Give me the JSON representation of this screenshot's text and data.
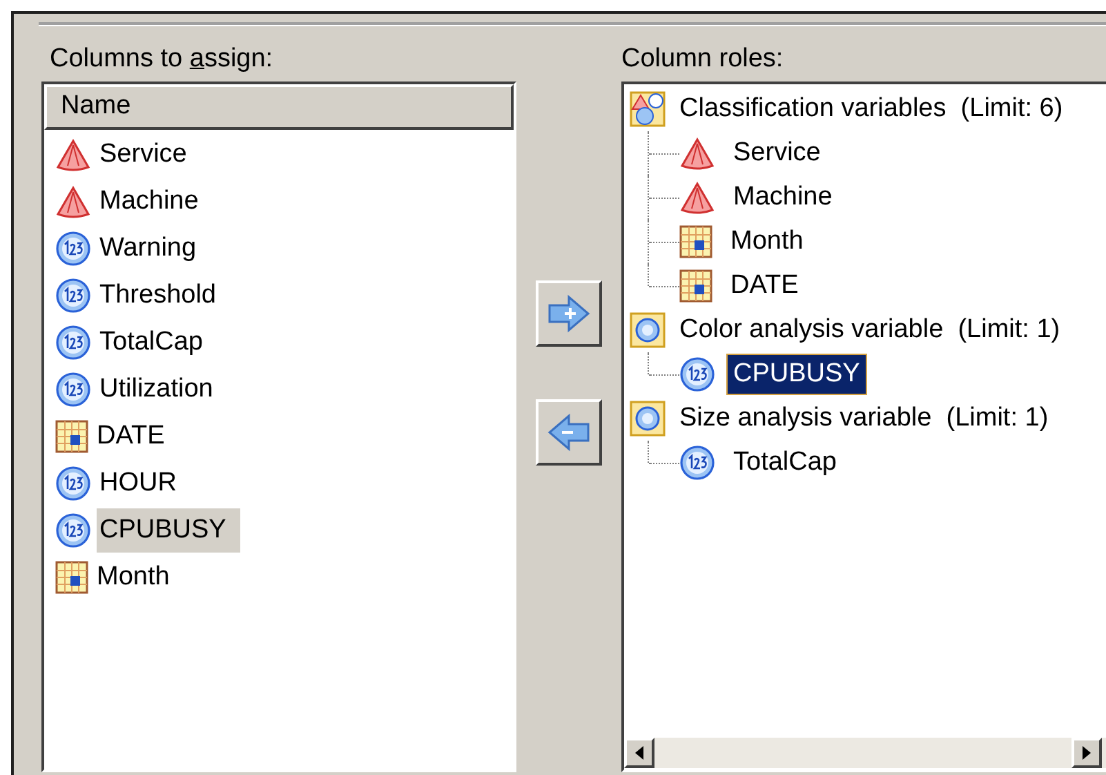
{
  "left": {
    "label": {
      "before": "Columns to ",
      "access_key": "a",
      "after": "ssign:"
    },
    "column_header": "Name",
    "items": [
      {
        "name": "Service",
        "kind": "category",
        "selected": false
      },
      {
        "name": "Machine",
        "kind": "category",
        "selected": false
      },
      {
        "name": "Warning",
        "kind": "numeric",
        "selected": false
      },
      {
        "name": "Threshold",
        "kind": "numeric",
        "selected": false
      },
      {
        "name": "TotalCap",
        "kind": "numeric",
        "selected": false
      },
      {
        "name": "Utilization",
        "kind": "numeric",
        "selected": false
      },
      {
        "name": "DATE",
        "kind": "date",
        "selected": false
      },
      {
        "name": "HOUR",
        "kind": "numeric",
        "selected": false
      },
      {
        "name": "CPUBUSY",
        "kind": "numeric",
        "selected": true
      },
      {
        "name": "Month",
        "kind": "date",
        "selected": false
      }
    ]
  },
  "buttons": [
    {
      "kind": "add"
    },
    {
      "kind": "remove"
    }
  ],
  "right": {
    "label": "Column roles:",
    "groups": [
      {
        "name": "Classification variables  (Limit: 6)",
        "kind": "classification",
        "children": [
          {
            "name": "Service",
            "kind": "category",
            "selected": false
          },
          {
            "name": "Machine",
            "kind": "category",
            "selected": false
          },
          {
            "name": "Month",
            "kind": "date",
            "selected": false
          },
          {
            "name": "DATE",
            "kind": "date",
            "selected": false
          }
        ]
      },
      {
        "name": "Color analysis variable  (Limit: 1)",
        "kind": "analysis",
        "children": [
          {
            "name": "CPUBUSY",
            "kind": "numeric",
            "selected": true
          }
        ]
      },
      {
        "name": "Size analysis variable  (Limit: 1)",
        "kind": "analysis",
        "children": [
          {
            "name": "TotalCap",
            "kind": "numeric",
            "selected": false
          }
        ]
      }
    ]
  }
}
